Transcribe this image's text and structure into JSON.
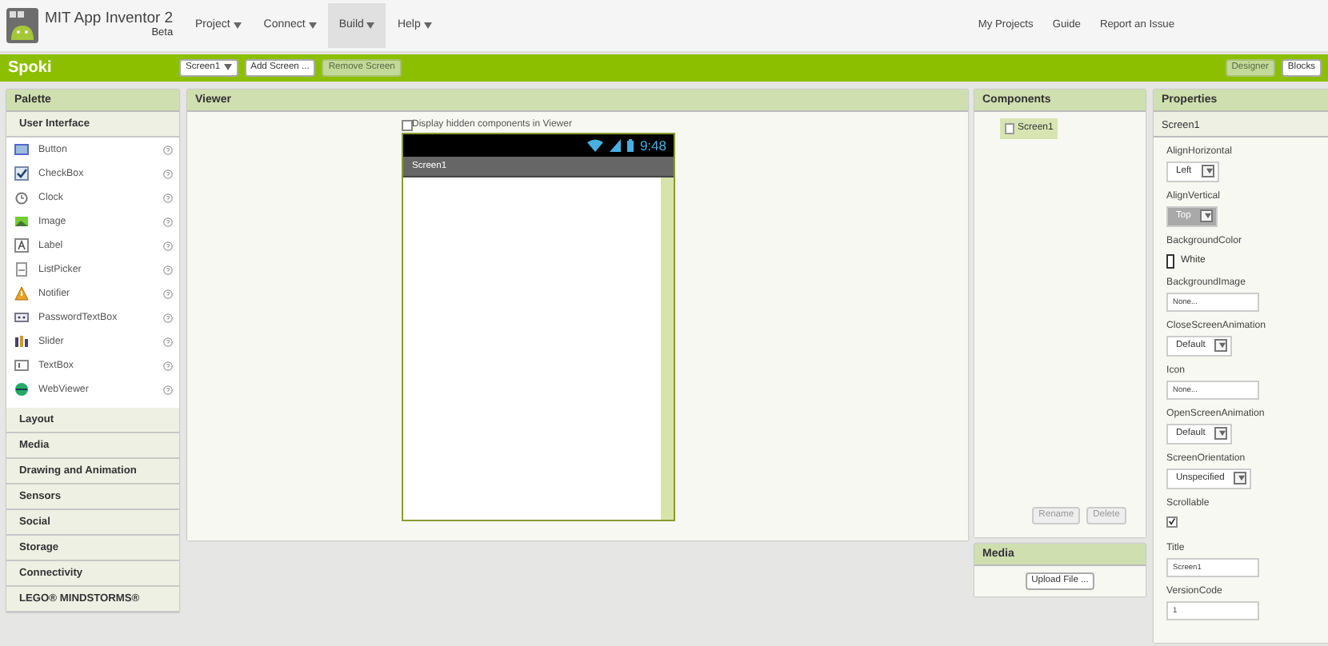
{
  "app": {
    "title": "MIT App Inventor 2",
    "subtitle": "Beta"
  },
  "menus": [
    {
      "label": "Project",
      "selected": false
    },
    {
      "label": "Connect",
      "selected": false
    },
    {
      "label": "Build",
      "selected": true
    },
    {
      "label": "Help",
      "selected": false
    }
  ],
  "top_links": [
    "My Projects",
    "Guide",
    "Report an Issue"
  ],
  "project": {
    "name": "Spoki",
    "screen_dropdown": "Screen1",
    "buttons": [
      {
        "label": "Add Screen ...",
        "disabled": false
      },
      {
        "label": "Remove Screen",
        "disabled": true
      }
    ],
    "views": [
      {
        "label": "Designer",
        "selected": true
      },
      {
        "label": "Blocks",
        "selected": false
      }
    ]
  },
  "palette": {
    "title": "Palette",
    "open_group": "User Interface",
    "items": [
      "Button",
      "CheckBox",
      "Clock",
      "Image",
      "Label",
      "ListPicker",
      "Notifier",
      "PasswordTextBox",
      "Slider",
      "TextBox",
      "WebViewer"
    ],
    "groups": [
      "Layout",
      "Media",
      "Drawing and Animation",
      "Sensors",
      "Social",
      "Storage",
      "Connectivity",
      "LEGO® MINDSTORMS®"
    ]
  },
  "viewer": {
    "title": "Viewer",
    "hidden_checkbox": {
      "label": "Display hidden components in Viewer",
      "checked": false
    },
    "phone": {
      "time": "9:48",
      "screen_title": "Screen1"
    }
  },
  "components": {
    "title": "Components",
    "tree": [
      {
        "label": "Screen1",
        "selected": true
      }
    ],
    "buttons": [
      {
        "label": "Rename",
        "disabled": true
      },
      {
        "label": "Delete",
        "disabled": true
      }
    ]
  },
  "media": {
    "title": "Media",
    "button": "Upload File ..."
  },
  "properties": {
    "title": "Properties",
    "component": "Screen1",
    "items": [
      {
        "label": "AlignHorizontal",
        "kind": "dropdown",
        "value": "Left",
        "disabled": false
      },
      {
        "label": "AlignVertical",
        "kind": "dropdown",
        "value": "Top",
        "disabled": true
      },
      {
        "label": "BackgroundColor",
        "kind": "color",
        "value": "White",
        "color": "#ffffff"
      },
      {
        "label": "BackgroundImage",
        "kind": "text",
        "value": "None..."
      },
      {
        "label": "CloseScreenAnimation",
        "kind": "dropdown",
        "value": "Default",
        "disabled": false
      },
      {
        "label": "Icon",
        "kind": "text",
        "value": "None..."
      },
      {
        "label": "OpenScreenAnimation",
        "kind": "dropdown",
        "value": "Default",
        "disabled": false
      },
      {
        "label": "ScreenOrientation",
        "kind": "dropdown",
        "value": "Unspecified",
        "disabled": false
      },
      {
        "label": "Scrollable",
        "kind": "checkbox",
        "checked": true
      },
      {
        "label": "Title",
        "kind": "text",
        "value": "Screen1"
      },
      {
        "label": "VersionCode",
        "kind": "text",
        "value": "1"
      }
    ]
  }
}
